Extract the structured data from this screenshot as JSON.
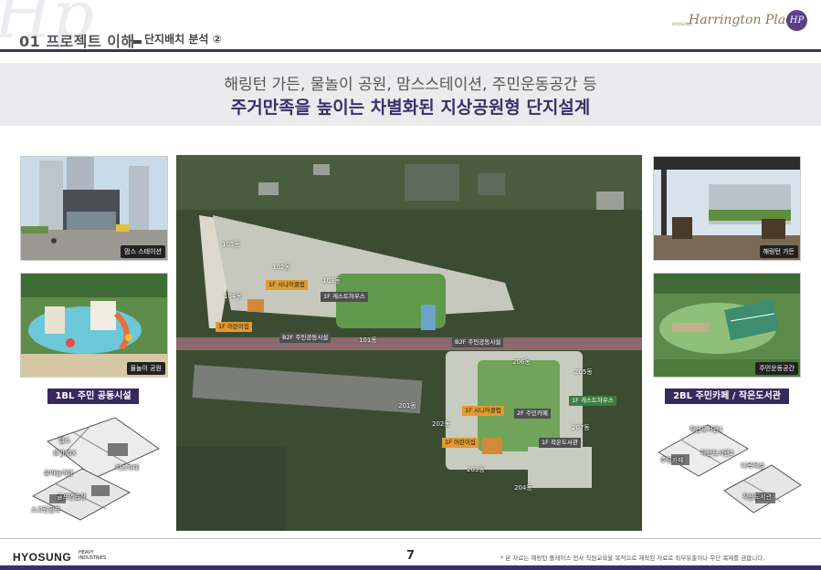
{
  "header": {
    "watermark": "Hp",
    "section_title": "01 프로젝트 이해",
    "section_sub": "단지배치 분석 ②",
    "brand_small": "HYOSUNG",
    "brand_script": "Harrington Place",
    "brand_logo": "HP"
  },
  "banner": {
    "line1": "해링턴 가든, 물놀이 공원, 맘스스테이션, 주민운동공간 등",
    "line2": "주거만족을 높이는 차별화된 지상공원형 단지설계"
  },
  "left": {
    "photo1_caption": "맘스 스테이션",
    "photo2_caption": "물놀이 공원",
    "label": "1BL 주민 공동시설",
    "floorplan": [
      "헬스",
      "요가/GX",
      "유아놀이방",
      "키즈카페",
      "스크린골프",
      "골프연습장"
    ]
  },
  "right": {
    "photo1_caption": "해링턴 가든",
    "photo2_caption": "주민운동공간",
    "label": "2BL 주민카페 / 작은도서관",
    "floorplan": [
      "작은도서관1",
      "작은도서관2",
      "주민카페",
      "다목적실",
      "작은도서관"
    ]
  },
  "map": {
    "buildings": [
      "105동",
      "102동",
      "103동",
      "104동",
      "101동",
      "206동",
      "205동",
      "201동",
      "202동",
      "203동",
      "204동",
      "207동"
    ],
    "tags": {
      "t1": "1F 시니어클럽",
      "t2": "1F 게스트하우스",
      "t3": "1F 어린이집",
      "t4": "B2F 주민공동시설",
      "t5": "B2F 주민공동시설",
      "t6": "1F 게스트하우스",
      "t7": "1F 시니어클럽",
      "t8": "2F 주민카페",
      "t9": "1F 어린이집",
      "t10": "1F 작은도서관"
    }
  },
  "footer": {
    "logo": "HYOSUNG",
    "logo_sub1": "HEAVY",
    "logo_sub2": "INDUSTRIES",
    "page": "7",
    "note": "* 본 자료는 해링턴 플레이스 전사 직원교육을 목적으로 제작된 자료로 외부유출이나 무단 복제를 금합니다."
  },
  "colors": {
    "primary": "#3b2f6a",
    "accent": "#e19a33",
    "green": "#3b7d45"
  }
}
